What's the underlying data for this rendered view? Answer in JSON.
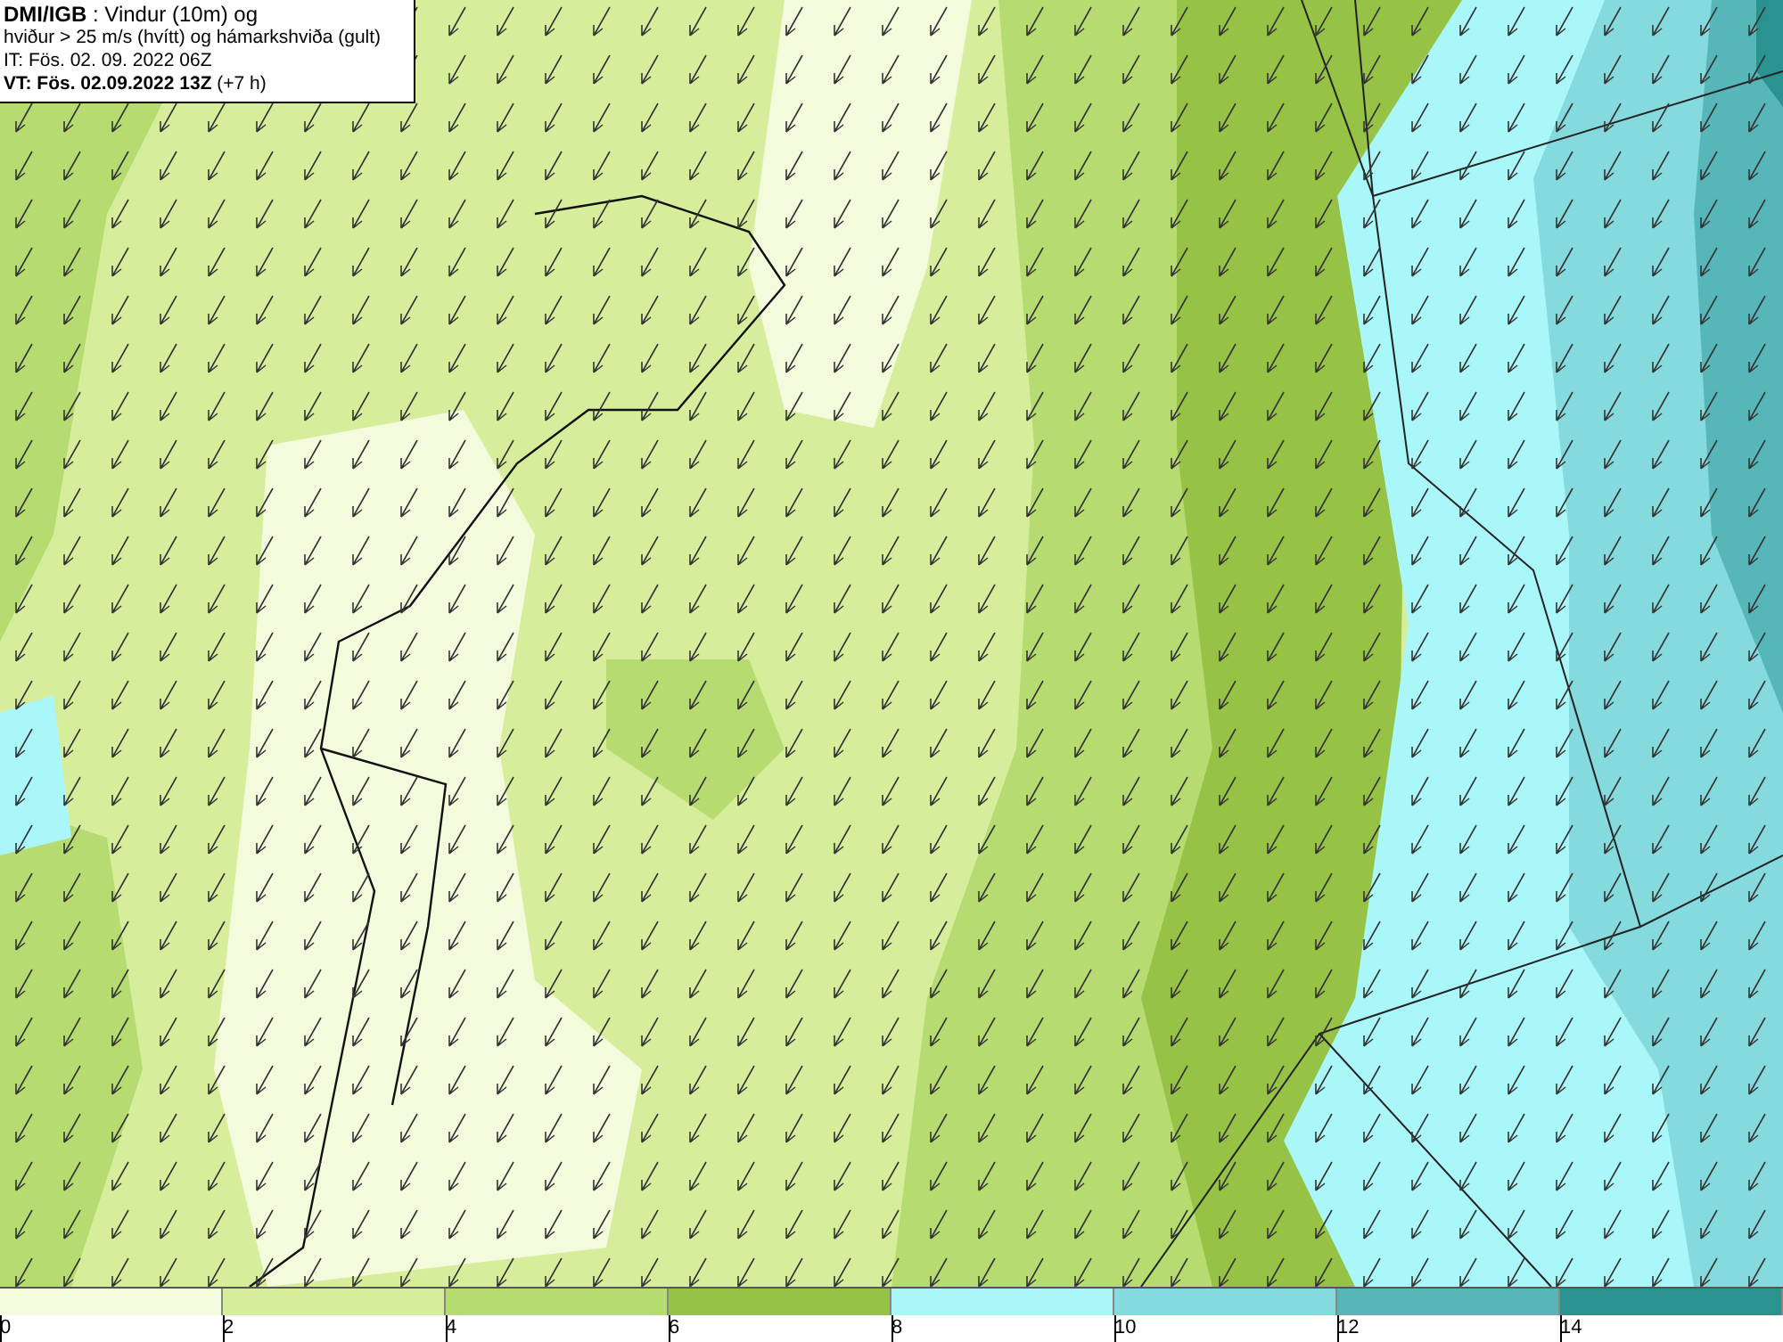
{
  "title_box": {
    "lines": [
      "**DMI/IGB** : Vindur (10m) og",
      "hviður > 25 m/s (hvítt) og hámarkshviða (gult)",
      "IT: Fös. 02. 09. 2022 06Z",
      "**VT: Fös. 02.09.2022 13Z** (+7 h)"
    ]
  },
  "legend": {
    "bins": [
      {
        "label": "0",
        "color": "#f4fbdc"
      },
      {
        "label": "2",
        "color": "#d6ee9c"
      },
      {
        "label": "4",
        "color": "#b6db70"
      },
      {
        "label": "6",
        "color": "#96c245"
      },
      {
        "label": "8",
        "color": "#aaf7f9"
      },
      {
        "label": "10",
        "color": "#84dadd"
      },
      {
        "label": "12",
        "color": "#57b6b8"
      },
      {
        "label": "14",
        "color": "#2a9390"
      }
    ]
  }
}
